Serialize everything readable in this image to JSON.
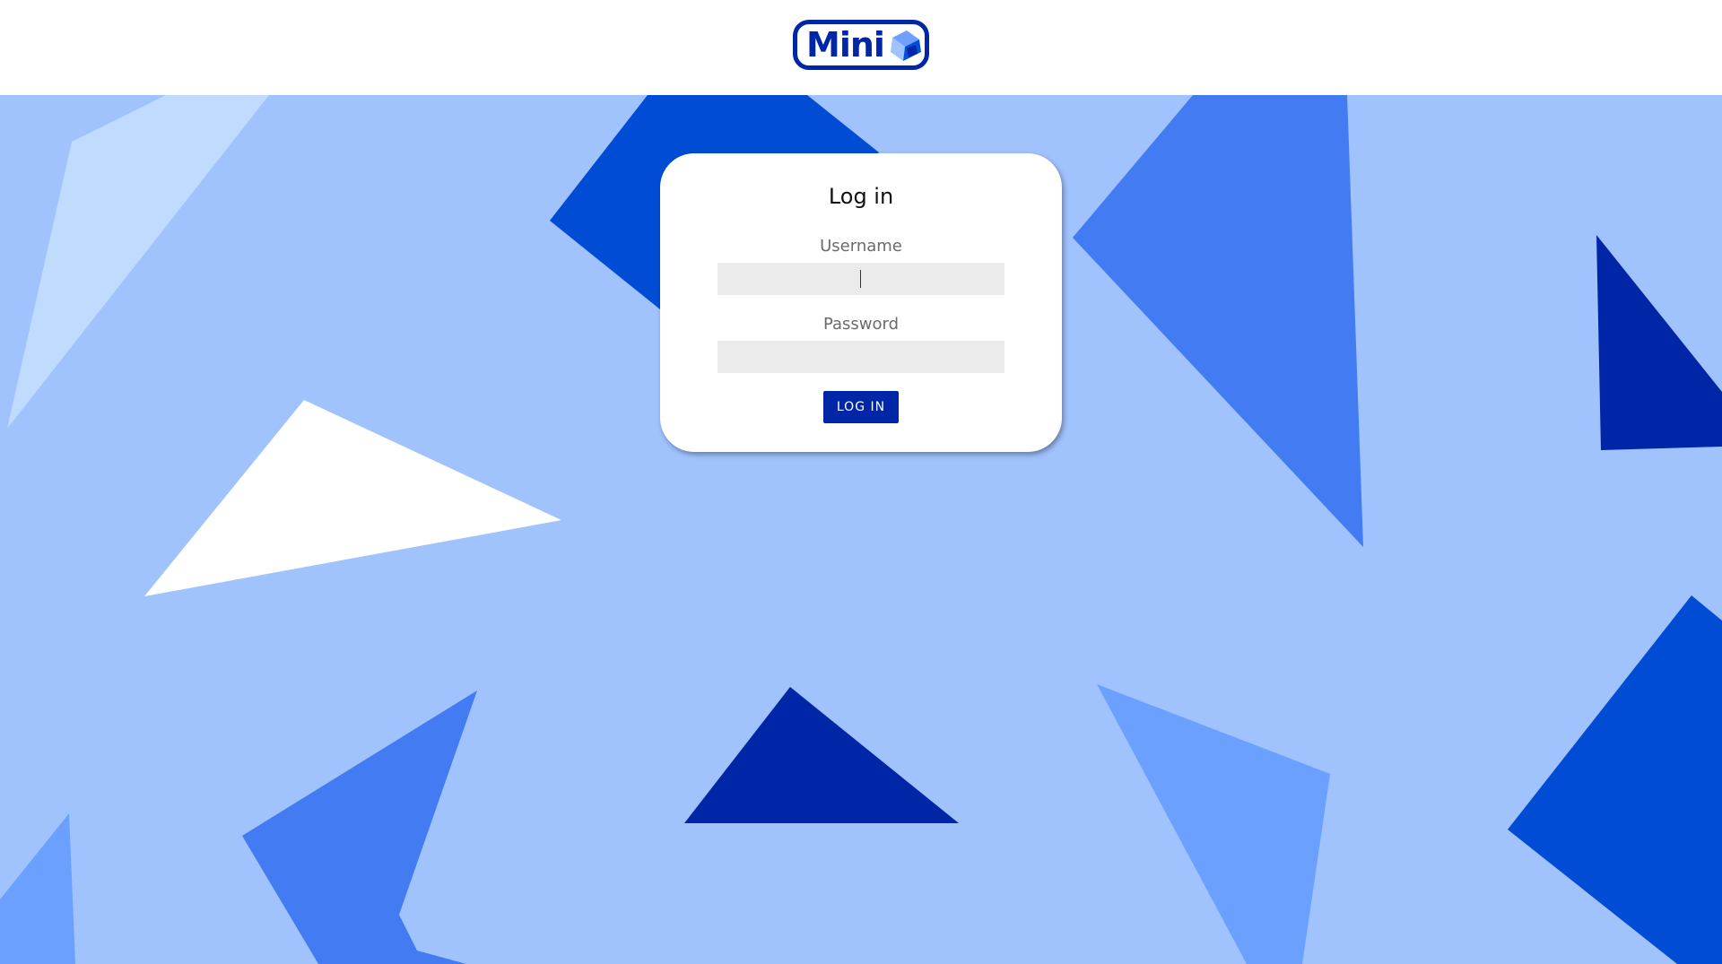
{
  "header": {
    "logo_text": "Mini",
    "logo_icon": "cube-icon"
  },
  "login": {
    "title": "Log in",
    "username_label": "Username",
    "username_value": "",
    "password_label": "Password",
    "password_value": "",
    "button_label": "LOG IN"
  },
  "colors": {
    "brand": "#0026a8",
    "background": "#a0c2fd",
    "input_bg": "#ebebeb"
  }
}
